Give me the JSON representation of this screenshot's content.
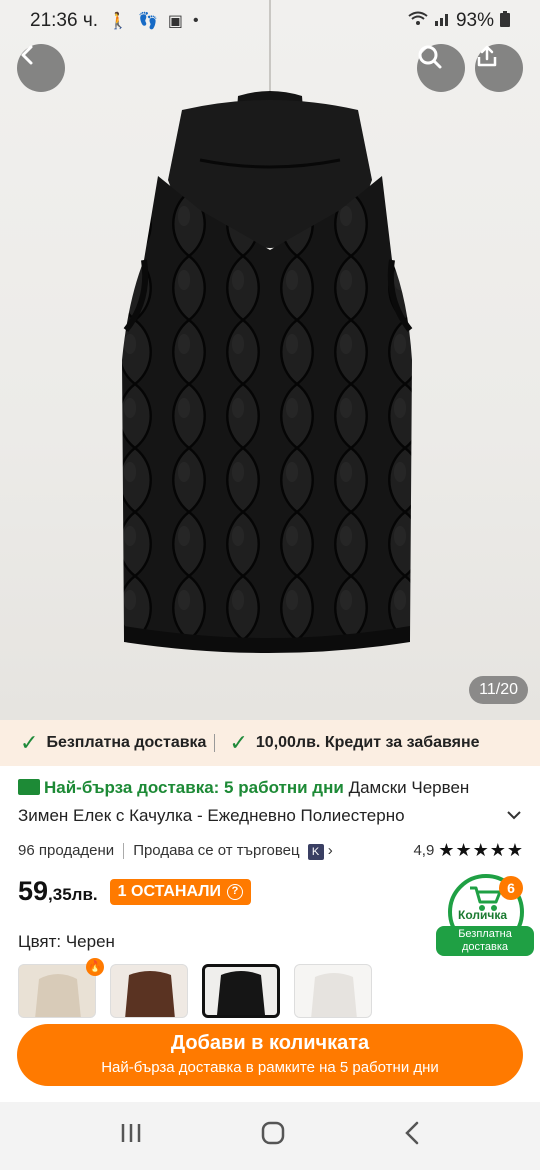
{
  "status_bar": {
    "time": "21:36 ч.",
    "battery": "93%"
  },
  "image_counter": "11/20",
  "delivery_strip": {
    "item1": "Безплатна доставка",
    "item2": "10,00лв. Кредит за забавяне"
  },
  "product": {
    "fast_delivery": "Най-бърза доставка: 5 работни дни",
    "title": "Дамски Червен Зимен Елек с Качулка - Ежедневно Полиестерно",
    "sold": "96 продадени",
    "seller": "Продава се от търговец",
    "rating": "4,9",
    "stars": "★★★★★",
    "price_main": "59",
    "price_rest": ",35лв.",
    "stock_badge": "1 ОСТАНАЛИ",
    "color_label": "Цвят: Черен"
  },
  "cart_badge": {
    "count": "6",
    "label": "Количка",
    "shipping": "Безплатна доставка"
  },
  "add_button": {
    "label": "Добави в количката",
    "sublabel": "Най-бърза доставка в рамките на 5 работни дни"
  },
  "colors": {
    "accent": "#ff7a00",
    "green": "#1fa044",
    "strip_bg": "#fbeee2"
  }
}
